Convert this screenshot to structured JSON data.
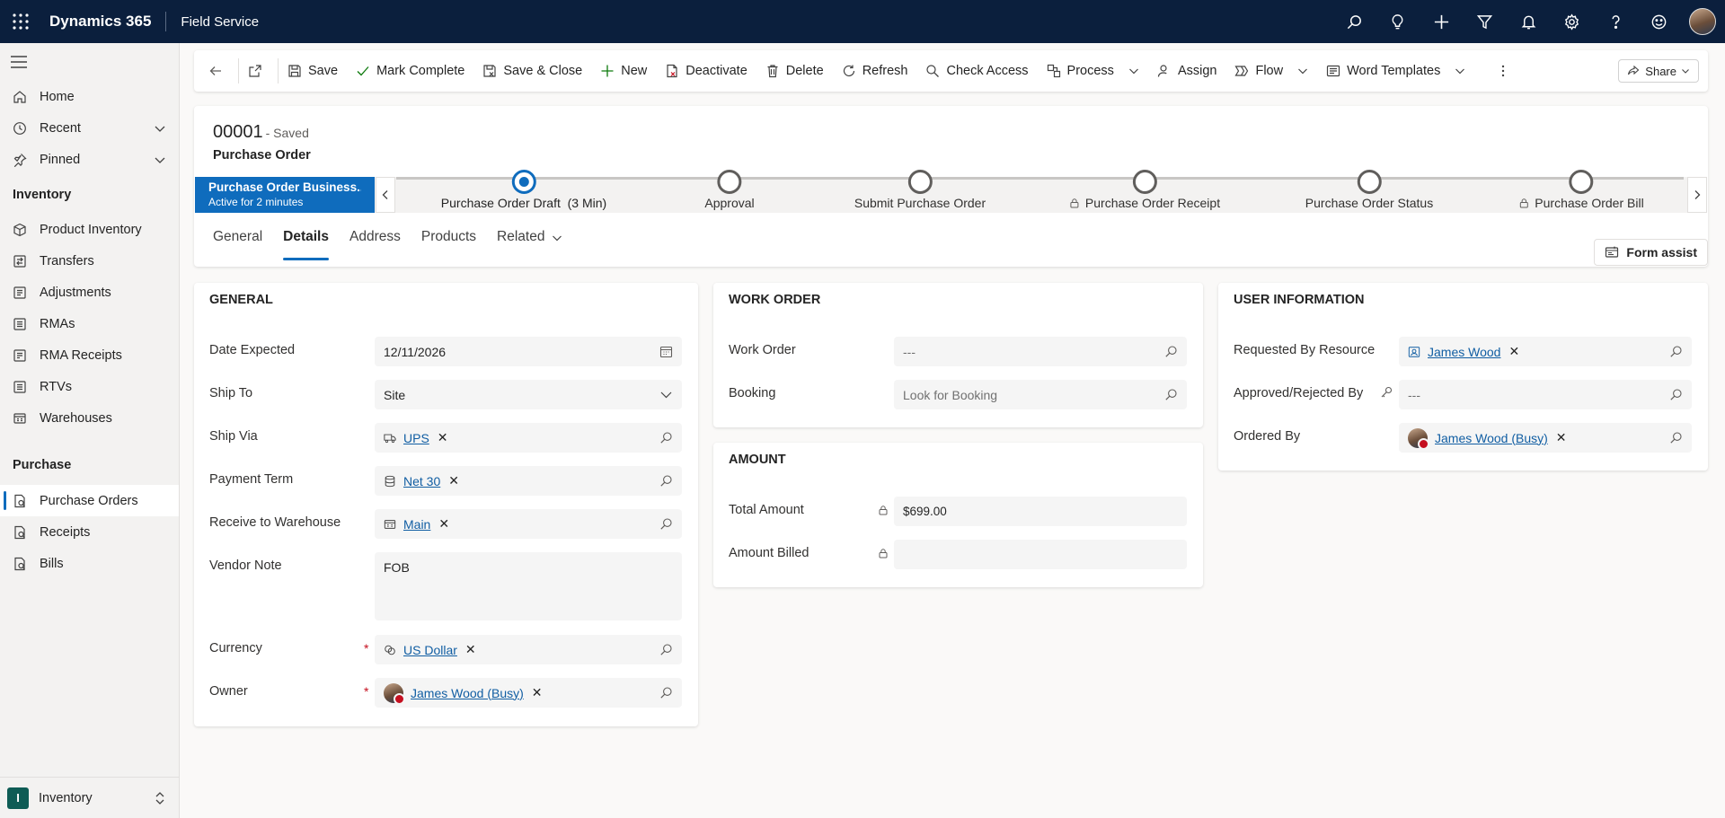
{
  "topbar": {
    "app_name": "Dynamics 365",
    "area_name": "Field Service",
    "icons": [
      "search-icon",
      "lightbulb-icon",
      "plus-icon",
      "filter-icon",
      "bell-icon",
      "gear-icon",
      "help-icon",
      "smiley-icon"
    ]
  },
  "sidebar": {
    "items_top": [
      {
        "label": "Home",
        "icon": "home-icon"
      },
      {
        "label": "Recent",
        "icon": "clock-icon"
      },
      {
        "label": "Pinned",
        "icon": "pin-icon"
      }
    ],
    "group_inventory": "Inventory",
    "inventory_items": [
      {
        "label": "Product Inventory"
      },
      {
        "label": "Transfers"
      },
      {
        "label": "Adjustments"
      },
      {
        "label": "RMAs"
      },
      {
        "label": "RMA Receipts"
      },
      {
        "label": "RTVs"
      },
      {
        "label": "Warehouses"
      }
    ],
    "group_purchase": "Purchase",
    "purchase_items": [
      {
        "label": "Purchase Orders",
        "active": true
      },
      {
        "label": "Receipts"
      },
      {
        "label": "Bills"
      }
    ],
    "area_badge": "I",
    "area_label": "Inventory"
  },
  "commands": {
    "save": "Save",
    "mark_complete": "Mark Complete",
    "save_close": "Save & Close",
    "new": "New",
    "deactivate": "Deactivate",
    "delete": "Delete",
    "refresh": "Refresh",
    "check_access": "Check Access",
    "process": "Process",
    "assign": "Assign",
    "flow": "Flow",
    "word_templates": "Word Templates",
    "share": "Share"
  },
  "header": {
    "record_number": "00001",
    "saved_status": "- Saved",
    "entity": "Purchase Order"
  },
  "bpf": {
    "active_title": "Purchase Order Business...",
    "active_sub": "Active for 2 minutes",
    "stages": [
      {
        "label": "Purchase Order Draft",
        "extra": "(3 Min)"
      },
      {
        "label": "Approval"
      },
      {
        "label": "Submit Purchase Order"
      },
      {
        "label": "Purchase Order Receipt"
      },
      {
        "label": "Purchase Order Status"
      },
      {
        "label": "Purchase Order Bill"
      }
    ]
  },
  "tabs": {
    "general": "General",
    "details": "Details",
    "address": "Address",
    "products": "Products",
    "related": "Related",
    "form_assist": "Form assist"
  },
  "general_section": {
    "title": "GENERAL",
    "date_expected_label": "Date Expected",
    "date_expected_value": "12/11/2026",
    "ship_to_label": "Ship To",
    "ship_to_value": "Site",
    "ship_via_label": "Ship Via",
    "ship_via_value": "UPS",
    "payment_term_label": "Payment Term",
    "payment_term_value": "Net 30",
    "receive_warehouse_label": "Receive to Warehouse",
    "receive_warehouse_value": "Main",
    "vendor_note_label": "Vendor Note",
    "vendor_note_value": "FOB",
    "currency_label": "Currency",
    "currency_value": "US Dollar",
    "owner_label": "Owner",
    "owner_value": "James Wood (Busy)",
    "required_mark": "*"
  },
  "work_order_section": {
    "title": "WORK ORDER",
    "work_order_label": "Work Order",
    "work_order_value": "---",
    "booking_label": "Booking",
    "booking_placeholder": "Look for Booking"
  },
  "amount_section": {
    "title": "AMOUNT",
    "total_amount_label": "Total Amount",
    "total_amount_value": "$699.00",
    "amount_billed_label": "Amount Billed",
    "amount_billed_value": ""
  },
  "user_info_section": {
    "title": "USER INFORMATION",
    "requested_by_label": "Requested By Resource",
    "requested_by_value": "James Wood",
    "approved_by_label": "Approved/Rejected By",
    "approved_by_value": "---",
    "ordered_by_label": "Ordered By",
    "ordered_by_value": "James Wood (Busy)"
  },
  "colors": {
    "topbar": "#0b1f3d",
    "accent": "#0f6cbd",
    "link": "#115ea3",
    "required": "#c50f1f",
    "area_badge": "#0e5c55"
  }
}
